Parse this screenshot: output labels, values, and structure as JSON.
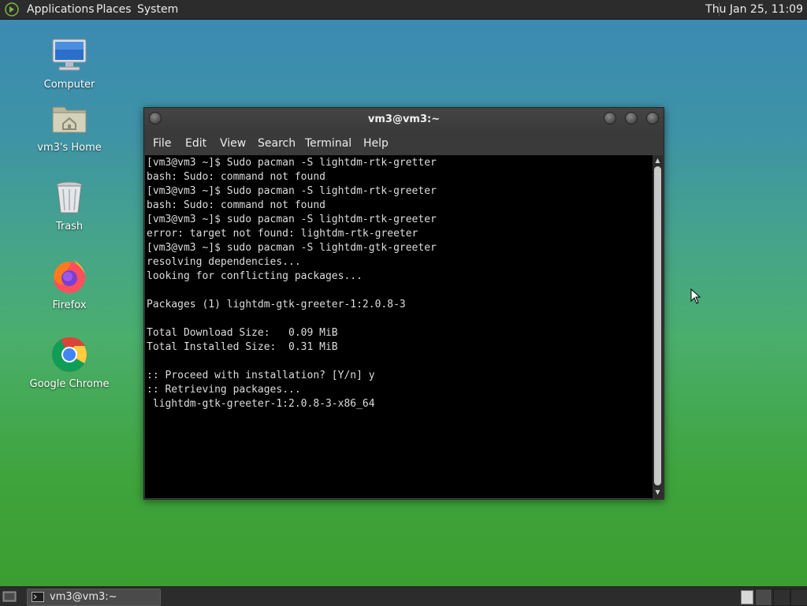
{
  "top_panel": {
    "menus": [
      "Applications",
      "Places",
      "System"
    ],
    "clock": "Thu Jan 25, 11:09",
    "logo_icon": "mate-logo-icon"
  },
  "desktop": {
    "icons": [
      {
        "label": "Computer",
        "icon": "computer-icon"
      },
      {
        "label": "vm3's Home",
        "icon": "home-folder-icon"
      },
      {
        "label": "Trash",
        "icon": "trash-icon"
      },
      {
        "label": "Firefox",
        "icon": "firefox-icon"
      },
      {
        "label": "Google Chrome",
        "icon": "chrome-icon"
      }
    ]
  },
  "terminal": {
    "title": "vm3@vm3:~",
    "menu": [
      "File",
      "Edit",
      "View",
      "Search",
      "Terminal",
      "Help"
    ],
    "lines": [
      "[vm3@vm3 ~]$ Sudo pacman -S lightdm-rtk-gretter",
      "bash: Sudo: command not found",
      "[vm3@vm3 ~]$ Sudo pacman -S lightdm-rtk-greeter",
      "bash: Sudo: command not found",
      "[vm3@vm3 ~]$ sudo pacman -S lightdm-rtk-greeter",
      "error: target not found: lightdm-rtk-greeter",
      "[vm3@vm3 ~]$ sudo pacman -S lightdm-gtk-greeter",
      "resolving dependencies...",
      "looking for conflicting packages...",
      "",
      "Packages (1) lightdm-gtk-greeter-1:2.0.8-3",
      "",
      "Total Download Size:   0.09 MiB",
      "Total Installed Size:  0.31 MiB",
      "",
      ":: Proceed with installation? [Y/n] y",
      ":: Retrieving packages...",
      " lightdm-gtk-greeter-1:2.0.8-3-x86_64"
    ]
  },
  "taskbar": {
    "task_label": "vm3@vm3:~"
  },
  "colors": {
    "panel": "#2c2c2c",
    "terminal_bg": "#000000",
    "terminal_fg": "#dcdcdc"
  }
}
